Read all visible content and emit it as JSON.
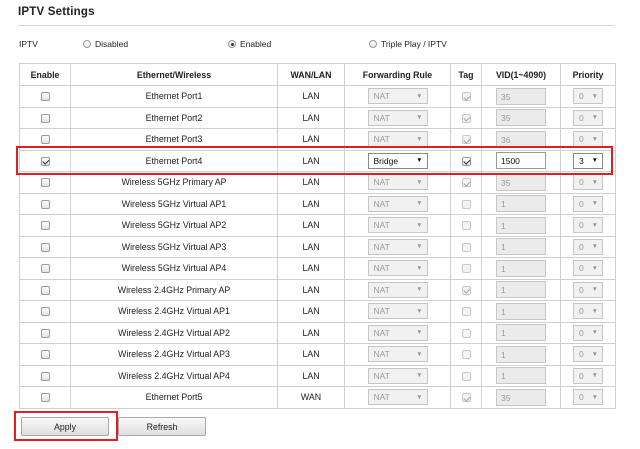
{
  "page": {
    "title": "IPTV Settings"
  },
  "iptv_mode": {
    "label": "IPTV",
    "options": [
      "Disabled",
      "Enabled",
      "Triple Play / IPTV"
    ],
    "selected": "Enabled"
  },
  "table": {
    "headers": [
      "Enable",
      "Ethernet/Wireless",
      "WAN/LAN",
      "Forwarding Rule",
      "Tag",
      "VID(1~4090)",
      "Priority"
    ],
    "rows": [
      {
        "enabled": false,
        "interface": "Ethernet Port1",
        "wan_lan": "LAN",
        "rule": "NAT",
        "tag": true,
        "vid": "35",
        "priority": "0"
      },
      {
        "enabled": false,
        "interface": "Ethernet Port2",
        "wan_lan": "LAN",
        "rule": "NAT",
        "tag": true,
        "vid": "35",
        "priority": "0"
      },
      {
        "enabled": false,
        "interface": "Ethernet Port3",
        "wan_lan": "LAN",
        "rule": "NAT",
        "tag": true,
        "vid": "36",
        "priority": "0"
      },
      {
        "enabled": true,
        "interface": "Ethernet Port4",
        "wan_lan": "LAN",
        "rule": "Bridge",
        "tag": true,
        "vid": "1500",
        "priority": "3"
      },
      {
        "enabled": false,
        "interface": "Wireless 5GHz Primary AP",
        "wan_lan": "LAN",
        "rule": "NAT",
        "tag": true,
        "vid": "35",
        "priority": "0"
      },
      {
        "enabled": false,
        "interface": "Wireless 5GHz Virtual AP1",
        "wan_lan": "LAN",
        "rule": "NAT",
        "tag": false,
        "vid": "1",
        "priority": "0"
      },
      {
        "enabled": false,
        "interface": "Wireless 5GHz Virtual AP2",
        "wan_lan": "LAN",
        "rule": "NAT",
        "tag": false,
        "vid": "1",
        "priority": "0"
      },
      {
        "enabled": false,
        "interface": "Wireless 5GHz Virtual AP3",
        "wan_lan": "LAN",
        "rule": "NAT",
        "tag": false,
        "vid": "1",
        "priority": "0"
      },
      {
        "enabled": false,
        "interface": "Wireless 5GHz Virtual AP4",
        "wan_lan": "LAN",
        "rule": "NAT",
        "tag": false,
        "vid": "1",
        "priority": "0"
      },
      {
        "enabled": false,
        "interface": "Wireless 2.4GHz Primary AP",
        "wan_lan": "LAN",
        "rule": "NAT",
        "tag": true,
        "vid": "1",
        "priority": "0"
      },
      {
        "enabled": false,
        "interface": "Wireless 2.4GHz Virtual AP1",
        "wan_lan": "LAN",
        "rule": "NAT",
        "tag": false,
        "vid": "1",
        "priority": "0"
      },
      {
        "enabled": false,
        "interface": "Wireless 2.4GHz Virtual AP2",
        "wan_lan": "LAN",
        "rule": "NAT",
        "tag": false,
        "vid": "1",
        "priority": "0"
      },
      {
        "enabled": false,
        "interface": "Wireless 2.4GHz Virtual AP3",
        "wan_lan": "LAN",
        "rule": "NAT",
        "tag": false,
        "vid": "1",
        "priority": "0"
      },
      {
        "enabled": false,
        "interface": "Wireless 2.4GHz Virtual AP4",
        "wan_lan": "LAN",
        "rule": "NAT",
        "tag": false,
        "vid": "1",
        "priority": "0"
      },
      {
        "enabled": false,
        "interface": "Ethernet Port5",
        "wan_lan": "WAN",
        "rule": "NAT",
        "tag": true,
        "vid": "35",
        "priority": "0"
      }
    ]
  },
  "buttons": {
    "apply": "Apply",
    "refresh": "Refresh"
  },
  "colors": {
    "highlight": "#e02020",
    "border": "#cfcfcf"
  },
  "icons": {
    "dropdown": "triangle-down-icon"
  }
}
